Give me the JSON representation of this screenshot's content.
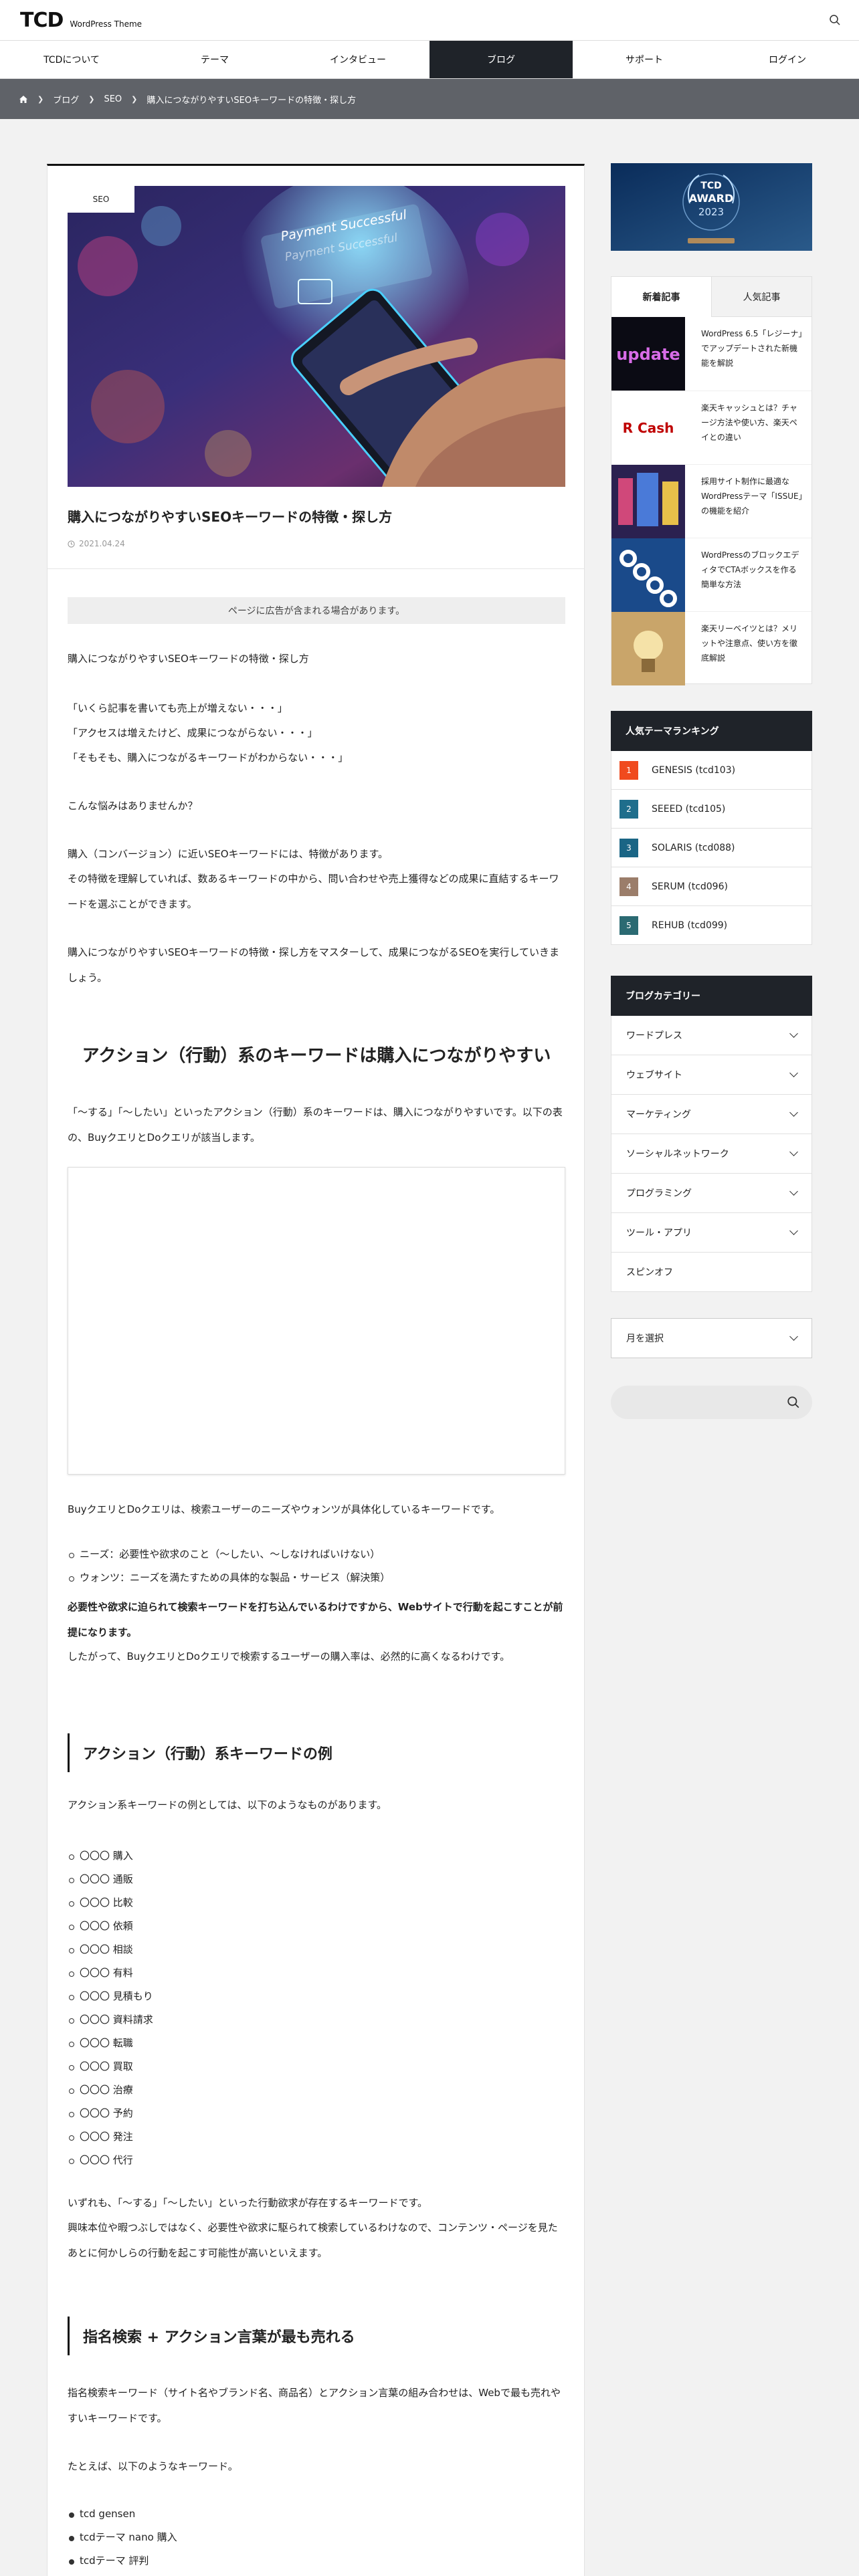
{
  "header": {
    "logo": "TCD",
    "logo_sub": "WordPress Theme",
    "search_icon": "search-icon"
  },
  "nav": [
    {
      "label": "TCDについて",
      "active": false
    },
    {
      "label": "テーマ",
      "active": false
    },
    {
      "label": "インタビュー",
      "active": false
    },
    {
      "label": "ブログ",
      "active": true
    },
    {
      "label": "サポート",
      "active": false
    },
    {
      "label": "ログイン",
      "active": false
    }
  ],
  "breadcrumb": {
    "home_icon": "home-icon",
    "items": [
      "ブログ",
      "SEO",
      "購入につながりやすいSEOキーワードの特徴・探し方"
    ]
  },
  "article": {
    "category": "SEO",
    "image_text": {
      "line1": "Payment Successful",
      "line2": "Payment Successful"
    },
    "title": "購入につながりやすいSEOキーワードの特徴・探し方",
    "date": "2021.04.24",
    "ad_notice": "ページに広告が含まれる場合があります。",
    "intro": [
      "購入につながりやすいSEOキーワードの特徴・探し方",
      "「いくら記事を書いても売上が増えない・・・」",
      "「アクセスは増えたけど、成果につながらない・・・」",
      "「そもそも、購入につながるキーワードがわからない・・・」",
      "こんな悩みはありませんか？",
      "購入（コンバージョン）に近いSEOキーワードには、特徴があります。",
      "その特徴を理解していれば、数あるキーワードの中から、問い合わせや売上獲得などの成果に直結するキーワードを選ぶことができます。",
      "購入につながりやすいSEOキーワードの特徴・探し方をマスターして、成果につながるSEOを実行していきましょう。"
    ],
    "h2_1": "アクション（行動）系のキーワードは購入につながりやすい",
    "p_action": "「〜する」「〜したい」といったアクション（行動）系のキーワードは、購入につながりやすいです。以下の表の、BuyクエリとDoクエリが該当します。",
    "p_buydo": "BuyクエリとDoクエリは、検索ユーザーのニーズやウォンツが具体化しているキーワードです。",
    "needs_list": [
      "ニーズ：必要性や欲求のこと（〜したい、〜しなければいけない）",
      "ウォンツ：ニーズを満たすための具体的な製品・サービス（解決策）"
    ],
    "p_bold": "必要性や欲求に迫られて検索キーワードを打ち込んでいるわけですから、Webサイトで行動を起こすことが前提になります。",
    "p_therefore": "したがって、BuyクエリとDoクエリで検索するユーザーの購入率は、必然的に高くなるわけです。",
    "h3_1": "アクション（行動）系キーワードの例",
    "p_examples": "アクション系キーワードの例としては、以下のようなものがあります。",
    "examples": [
      "〇〇〇 購入",
      "〇〇〇 通販",
      "〇〇〇 比較",
      "〇〇〇 依頼",
      "〇〇〇 相談",
      "〇〇〇 有料",
      "〇〇〇 見積もり",
      "〇〇〇 資料請求",
      "〇〇〇 転職",
      "〇〇〇 買取",
      "〇〇〇 治療",
      "〇〇〇 予約",
      "〇〇〇 発注",
      "〇〇〇 代行"
    ],
    "p_desire1": "いずれも、「〜する」「〜したい」といった行動欲求が存在するキーワードです。",
    "p_desire2": "興味本位や暇つぶしではなく、必要性や欲求に駆られて検索しているわけなので、コンテンツ・ページを見たあとに何かしらの行動を起こす可能性が高いといえます。",
    "h3_2": "指名検索 + アクション言葉が最も売れる",
    "p_brand": "指名検索キーワード（サイト名やブランド名、商品名）とアクション言葉の組み合わせは、Webで最も売れやすいキーワードです。",
    "p_forexample": "たとえば、以下のようなキーワード。",
    "brand_list": [
      "tcd gensen",
      "tcdテーマ nano 購入",
      "tcdテーマ 評判"
    ]
  },
  "sidebar": {
    "award": {
      "line1": "TCD",
      "line2": "AWARD",
      "line3": "2023"
    },
    "tabs": [
      "新着記事",
      "人気記事"
    ],
    "recent_posts": [
      {
        "title": "WordPress 6.5「レジーナ」でアップデートされた新機能を解説",
        "thumb_text": "update"
      },
      {
        "title": "楽天キャッシュとは？チャージ方法や使い方、楽天ペイとの違い",
        "thumb_text": "R Cash"
      },
      {
        "title": "採用サイト制作に最適なWordPressテーマ「ISSUE」の機能を紹介",
        "thumb_text": ""
      },
      {
        "title": "WordPressのブロックエディタでCTAボックスを作る簡単な方法",
        "thumb_text": ""
      },
      {
        "title": "楽天リーベイツとは？メリットや注意点、使い方を徹底解説",
        "thumb_text": ""
      }
    ],
    "ranking_title": "人気テーマランキング",
    "ranking": [
      {
        "rank": "1",
        "name": "GENESIS (tcd103)",
        "color": "#f04a1e"
      },
      {
        "rank": "2",
        "name": "SEEED (tcd105)",
        "color": "#1f6e8c"
      },
      {
        "rank": "3",
        "name": "SOLARIS (tcd088)",
        "color": "#1a6585"
      },
      {
        "rank": "4",
        "name": "SERUM (tcd096)",
        "color": "#9b7d6a"
      },
      {
        "rank": "5",
        "name": "REHUB (tcd099)",
        "color": "#2b6a72"
      }
    ],
    "category_title": "ブログカテゴリー",
    "categories": [
      {
        "label": "ワードプレス",
        "chevron": true
      },
      {
        "label": "ウェブサイト",
        "chevron": true
      },
      {
        "label": "マーケティング",
        "chevron": true
      },
      {
        "label": "ソーシャルネットワーク",
        "chevron": true
      },
      {
        "label": "プログラミング",
        "chevron": true
      },
      {
        "label": "ツール・アプリ",
        "chevron": true
      },
      {
        "label": "スピンオフ",
        "chevron": false
      }
    ],
    "archive_select": "月を選択",
    "search_placeholder": ""
  }
}
